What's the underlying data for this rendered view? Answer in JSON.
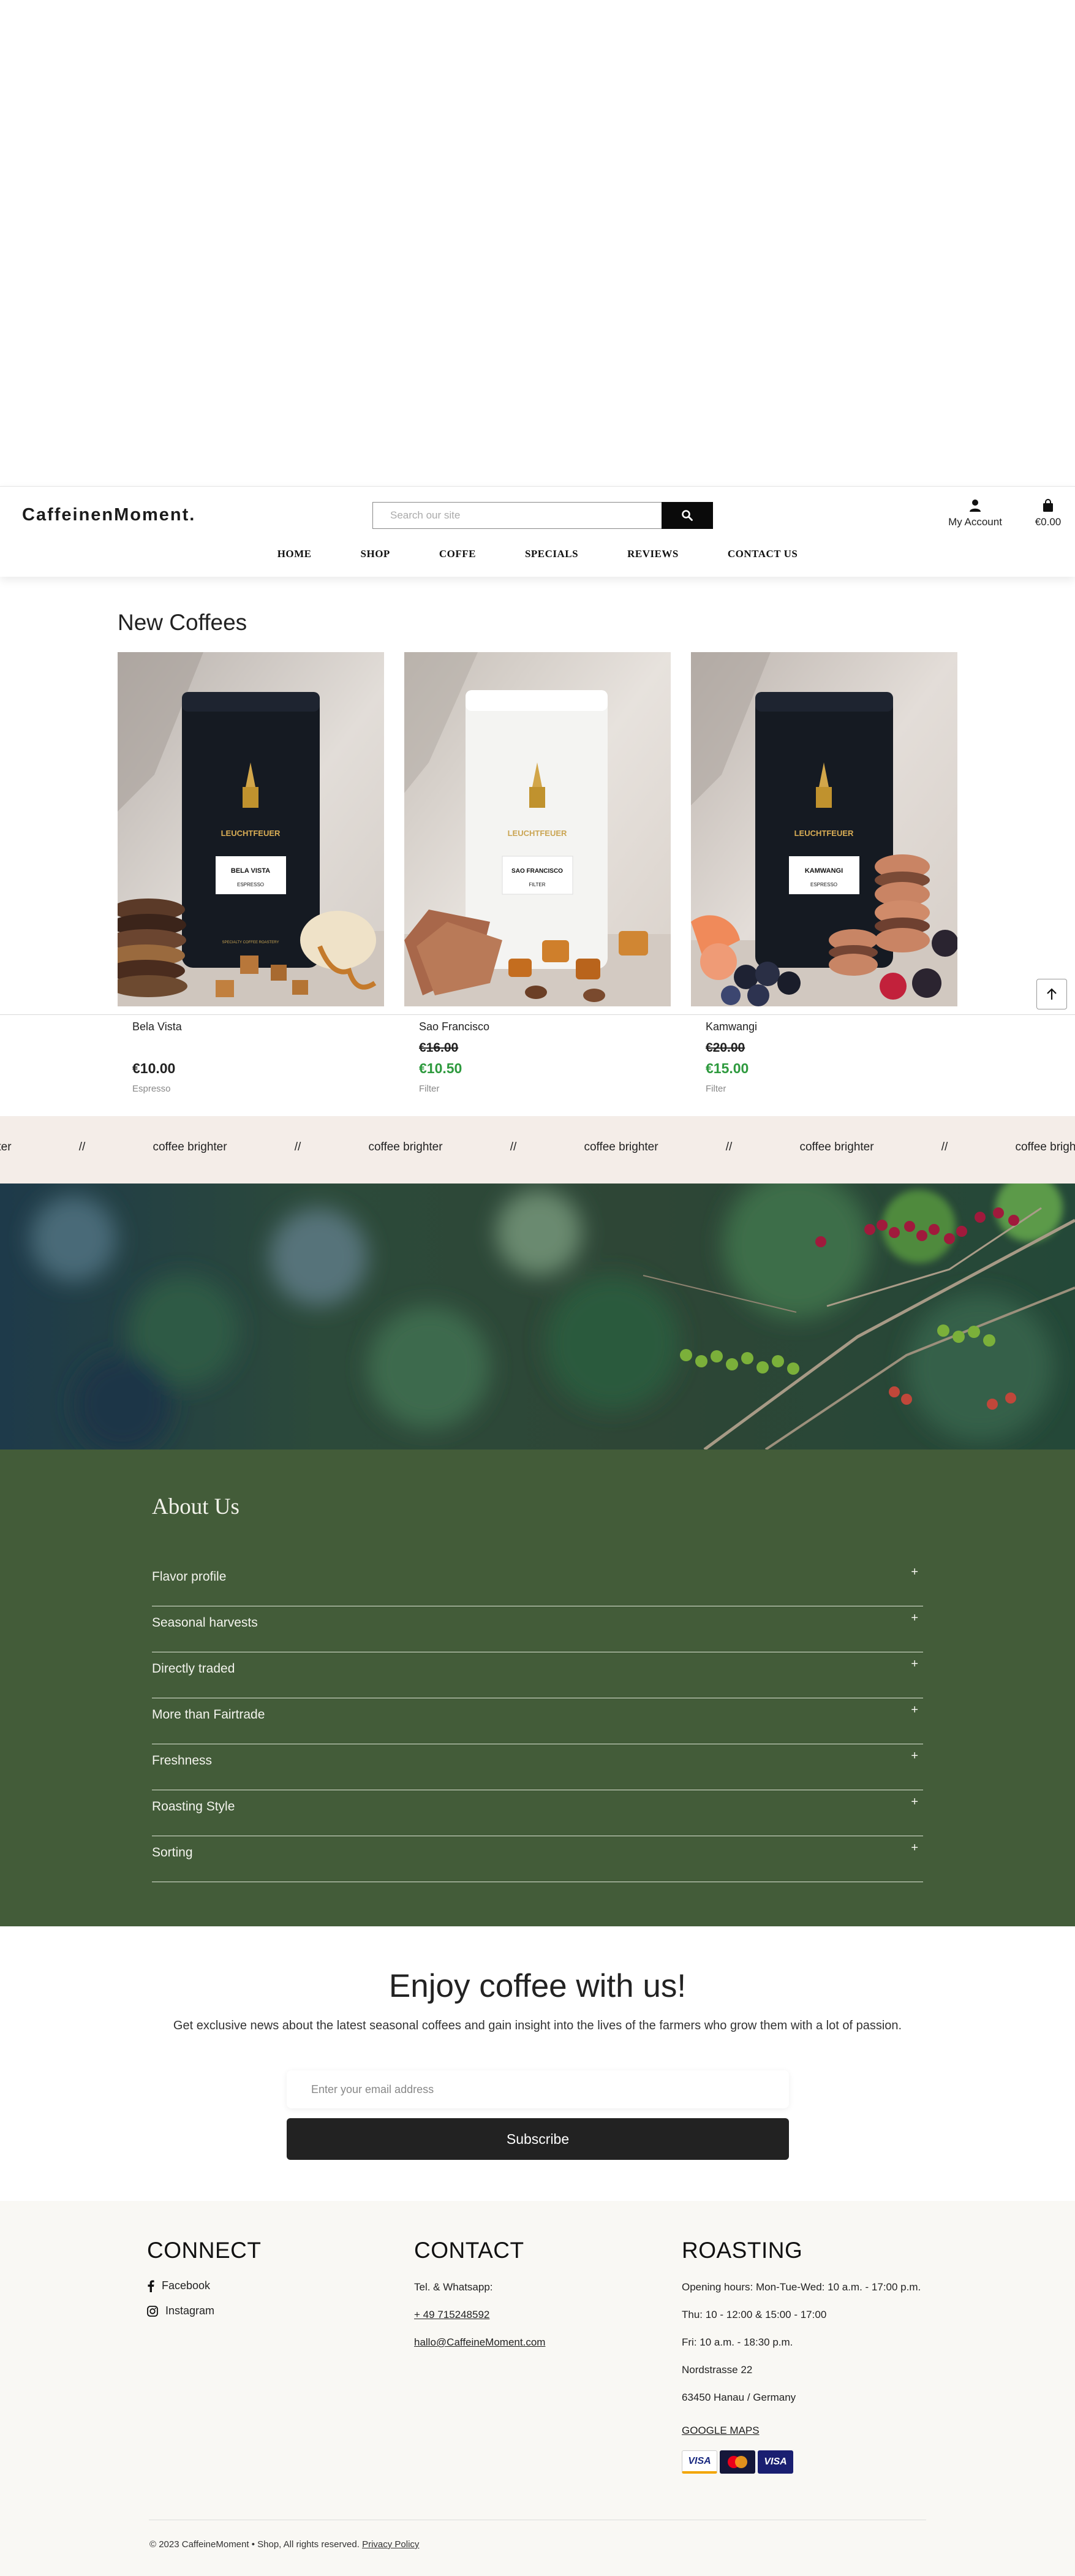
{
  "header": {
    "logo": "CaffeinenMoment.",
    "search_placeholder": "Search our site",
    "account_label": "My Account",
    "cart_total": "€0.00"
  },
  "nav": [
    "HOME",
    "SHOP",
    "COFFE",
    "SPECIALS",
    "REVIEWS",
    "CONTACT US"
  ],
  "new_coffees": {
    "title": "New Coffees",
    "products": [
      {
        "name": "Bela Vista",
        "old_price": "",
        "price": "€10.00",
        "category": "Espresso",
        "pack_label": "BELA VISTA",
        "pack_sub": "ESPRESSO",
        "pack_color": "#151a22",
        "on_sale": false
      },
      {
        "name": "Sao Francisco",
        "old_price": "€16.00",
        "price": "€10.50",
        "category": "Filter",
        "pack_label": "SAO FRANCISCO",
        "pack_sub": "FILTER",
        "pack_color": "#f4f4f2",
        "on_sale": true
      },
      {
        "name": "Kamwangi",
        "old_price": "€20.00",
        "price": "€15.00",
        "category": "Filter",
        "pack_label": "KAMWANGI",
        "pack_sub": "ESPRESSO",
        "pack_color": "#151a22",
        "on_sale": true
      }
    ],
    "brand_on_pack": "LEUCHTFEUER",
    "pack_tagline": "SPECIALTY COFFEE ROASTERY"
  },
  "marquee": {
    "text": "coffee brighter",
    "separator": "//"
  },
  "about": {
    "title": "About Us",
    "items": [
      "Flavor profile",
      "Seasonal harvests",
      "Directly traded",
      "More than Fairtrade",
      "Freshness",
      "Roasting Style",
      "Sorting"
    ]
  },
  "newsletter": {
    "title": "Enjoy coffee with us!",
    "text": "Get exclusive news about the latest seasonal coffees and gain insight into the lives of the farmers who grow them with a lot of passion.",
    "email_placeholder": "Enter your email address",
    "button": "Subscribe"
  },
  "footer": {
    "connect": {
      "title": "CONNECT",
      "facebook": "Facebook",
      "instagram": "Instagram"
    },
    "contact": {
      "title": "CONTACT",
      "tel_label": "Tel. & Whatsapp:",
      "phone": "+ 49 715248592",
      "email": "hallo@CaffeineMoment.com"
    },
    "roasting": {
      "title": "ROASTING",
      "hours1": "Opening hours: Mon-Tue-Wed: 10 a.m. - 17:00 p.m.",
      "hours2": "Thu: 10 - 12:00 & 15:00 - 17:00",
      "hours3": "Fri: 10 a.m. - 18:30 p.m.",
      "street": "Nordstrasse 22",
      "city": "63450 Hanau / Germany",
      "maps": "GOOGLE MAPS"
    },
    "payments": [
      "VISA",
      "mastercard",
      "VISA"
    ],
    "copyright": "© 2023 CaffeineMoment • Shop, All rights reserved.",
    "privacy": "Privacy Policy"
  },
  "colors": {
    "green": "#435c39",
    "sale": "#2e9a3e",
    "marquee_bg": "#f4ede8",
    "footer_bg": "#f9f8f4"
  }
}
